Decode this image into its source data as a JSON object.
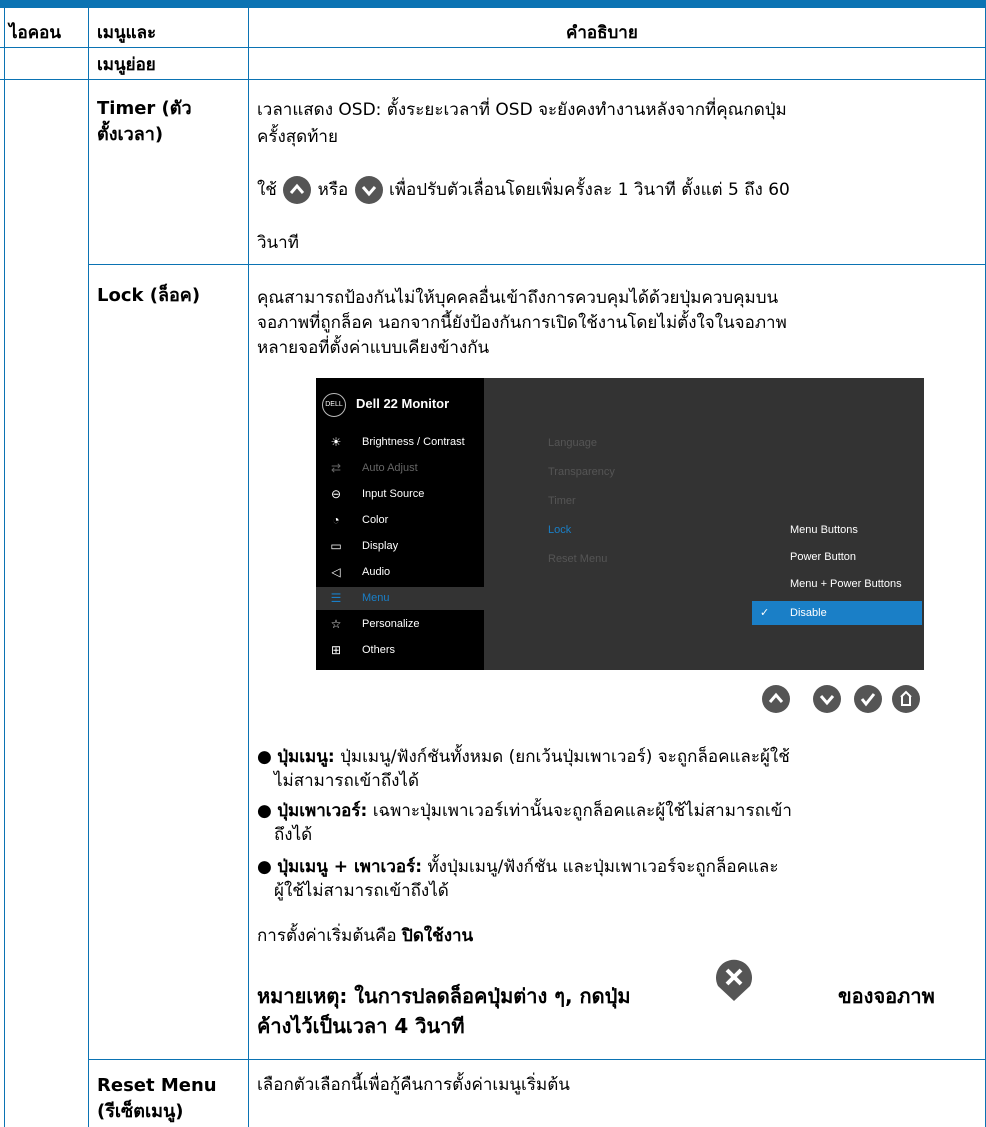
{
  "header": {
    "col_icon": "ไอคอน",
    "col_menu_line1": "เมนูและ",
    "col_menu_line2": "เมนูย่อย",
    "col_desc": "คำอธิบาย"
  },
  "rows": {
    "timer": {
      "name_line1": "Timer (ตัว",
      "name_line2": "ตั้งเวลา)",
      "desc_line1": "เวลาแสดง OSD: ตั้งระยะเวลาที่ OSD จะยังคงทำงานหลังจากที่คุณกดปุ่ม",
      "desc_line2": "ครั้งสุดท้าย",
      "use_prefix": "ใช้",
      "use_or": "หรือ",
      "use_suffix": "เพื่อปรับตัวเลื่อนโดยเพิ่มครั้งละ 1 วินาที ตั้งแต่ 5 ถึง 60",
      "use_seconds": "วินาที"
    },
    "lock": {
      "name": "Lock (ล็อค)",
      "desc_line1": "คุณสามารถป้องกันไม่ให้บุคคลอื่นเข้าถึงการควบคุมได้ด้วยปุ่มควบคุมบน",
      "desc_line2": "จอภาพที่ถูกล็อค นอกจากนี้ยังป้องกันการเปิดใช้งานโดยไม่ตั้งใจในจอภาพ",
      "desc_line3": "หลายจอที่ตั้งค่าแบบเคียงข้างกัน",
      "bullets": [
        {
          "title": "ปุ่มเมนู:",
          "line1": "ปุ่มเมนู/ฟังก์ชันทั้งหมด (ยกเว้นปุ่มเพาเวอร์) จะถูกล็อคและผู้ใช้",
          "line2": "ไม่สามารถเข้าถึงได้"
        },
        {
          "title": "ปุ่มเพาเวอร์:",
          "line1": "เฉพาะปุ่มเพาเวอร์เท่านั้นจะถูกล็อคและผู้ใช้ไม่สามารถเข้า",
          "line2": "ถึงได้"
        },
        {
          "title": "ปุ่มเมนู + เพาเวอร์:",
          "line1": "ทั้งปุ่มเมนู/ฟังก์ชัน และปุ่มเพาเวอร์จะถูกล็อคและ",
          "line2": "ผู้ใช้ไม่สามารถเข้าถึงได้"
        }
      ],
      "default_prefix": "การตั้งค่าเริ่มต้นคือ",
      "default_value": "ปิดใช้งาน",
      "note_part1": "หมายเหตุ: ในการปลดล็อคปุ่มต่าง ๆ, กดปุ่ม",
      "note_part2": "ของจอภาพ",
      "note_line2": "ค้างไว้เป็นเวลา 4 วินาที"
    },
    "reset": {
      "name_line1": "Reset Menu",
      "name_line2": "(รีเซ็ตเมนู)",
      "desc": "เลือกตัวเลือกนี้เพื่อกู้คืนการตั้งค่าเมนูเริ่มต้น"
    }
  },
  "osd": {
    "logo": "DELL",
    "title": "Dell 22 Monitor",
    "left_items": [
      {
        "icon": "brightness-icon",
        "glyph": "☀",
        "label": "Brightness / Contrast",
        "state": "normal"
      },
      {
        "icon": "auto-adjust-icon",
        "glyph": "⇄",
        "label": "Auto Adjust",
        "state": "dim"
      },
      {
        "icon": "input-source-icon",
        "glyph": "⊖",
        "label": "Input Source",
        "state": "normal"
      },
      {
        "icon": "color-icon",
        "glyph": "◔",
        "label": "Color",
        "state": "normal"
      },
      {
        "icon": "display-icon",
        "glyph": "▭",
        "label": "Display",
        "state": "normal"
      },
      {
        "icon": "audio-icon",
        "glyph": "◁",
        "label": "Audio",
        "state": "normal"
      },
      {
        "icon": "menu-icon",
        "glyph": "☰",
        "label": "Menu",
        "state": "selected"
      },
      {
        "icon": "personalize-icon",
        "glyph": "☆",
        "label": "Personalize",
        "state": "normal"
      },
      {
        "icon": "others-icon",
        "glyph": "⊞",
        "label": "Others",
        "state": "normal"
      }
    ],
    "mid_items": [
      "Language",
      "Transparency",
      "Timer",
      "Lock",
      "Reset Menu"
    ],
    "right_items": [
      "Menu Buttons",
      "Power Button",
      "Menu + Power Buttons"
    ],
    "selected_option": "Disable",
    "nav_buttons": [
      "up-icon",
      "down-icon",
      "check-icon",
      "back-icon"
    ]
  },
  "colors": {
    "rule": "#0b73b3",
    "osd_accent": "#1a7fc7",
    "button": "#555555"
  }
}
